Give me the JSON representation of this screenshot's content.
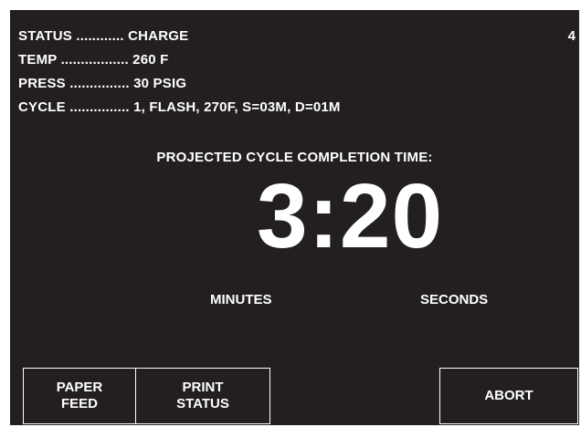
{
  "status_panel": {
    "lines": [
      "STATUS ............ CHARGE",
      "TEMP ................. 260 F",
      "PRESS ............... 30 PSIG",
      "CYCLE ............... 1, FLASH, 270F, S=03M, D=01M"
    ],
    "page_number": "4"
  },
  "countdown": {
    "label": "PROJECTED CYCLE COMPLETION TIME:",
    "time": "3:20",
    "minutes_label": "MINUTES",
    "seconds_label": "SECONDS"
  },
  "buttons": {
    "paper_feed": "PAPER\nFEED",
    "print_status": "PRINT\nSTATUS",
    "abort": "ABORT"
  }
}
